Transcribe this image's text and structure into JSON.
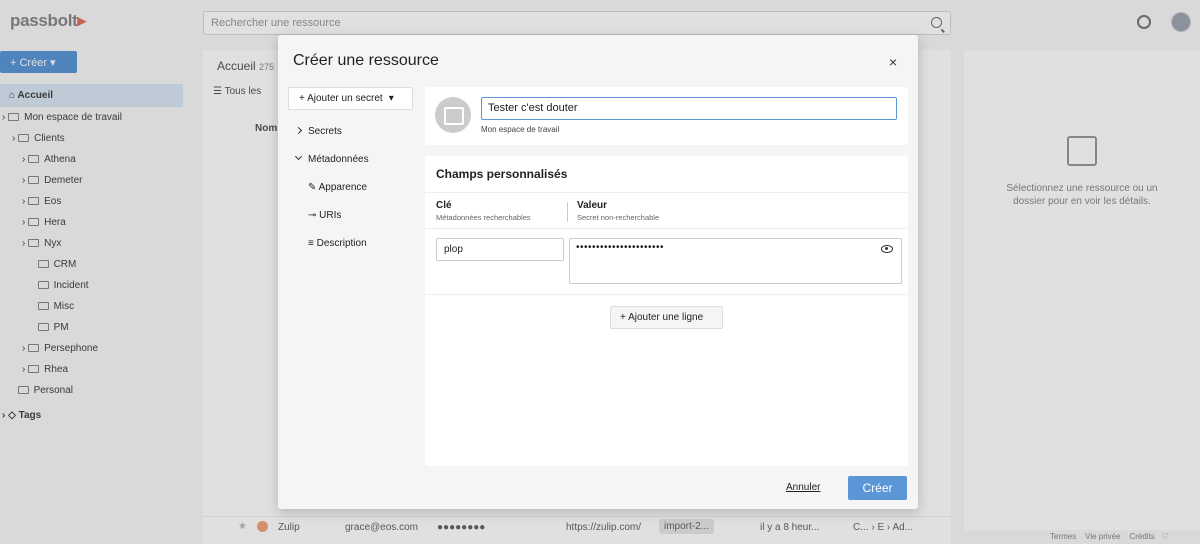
{
  "app": {
    "logo": "passbolt",
    "search_placeholder": "Rechercher une ressource",
    "create_label": "+ Créer ▾"
  },
  "sidebar": {
    "home": "Accueil",
    "tree": [
      {
        "label": "Mon espace de travail",
        "indent": 0
      },
      {
        "label": "Clients",
        "indent": 1
      },
      {
        "label": "Athena",
        "indent": 2
      },
      {
        "label": "Demeter",
        "indent": 2
      },
      {
        "label": "Eos",
        "indent": 2
      },
      {
        "label": "Hera",
        "indent": 2
      },
      {
        "label": "Nyx",
        "indent": 2
      },
      {
        "label": "CRM",
        "indent": 3
      },
      {
        "label": "Incident",
        "indent": 3
      },
      {
        "label": "Misc",
        "indent": 3
      },
      {
        "label": "PM",
        "indent": 3
      },
      {
        "label": "Persephone",
        "indent": 2
      },
      {
        "label": "Rhea",
        "indent": 2
      },
      {
        "label": "Personal",
        "indent": 1
      }
    ],
    "tags": "Tags"
  },
  "grid": {
    "title": "Accueil",
    "count": "275",
    "filter": "Tous les",
    "col_name": "Nom",
    "visible_row": {
      "name": "Zulip",
      "user": "grace@eos.com",
      "password": "●●●●●●●●",
      "uri": "https://zulip.com/",
      "tag": "import-2...",
      "modified": "il y a 8 heur...",
      "location": "C... › E › Ad..."
    }
  },
  "details": {
    "empty_text": "Sélectionnez une ressource ou un dossier pour en voir les détails."
  },
  "footer": {
    "terms": "Termes",
    "privacy": "Vie privée",
    "credits": "Crédits"
  },
  "modal": {
    "title": "Créer une ressource",
    "close": "×",
    "add_secret": "Ajouter un secret",
    "nav": {
      "secrets": "Secrets",
      "metadata": "Métadonnées",
      "appearance": "Apparence",
      "uris": "URIs",
      "description": "Description"
    },
    "resource_name": "Tester c'est douter",
    "resource_location": "Mon espace de travail",
    "custom_fields": {
      "title": "Champs personnalisés",
      "key_header": "Clé",
      "key_sub": "Métadonnées recherchables",
      "value_header": "Valeur",
      "value_sub": "Secret non-recherchable",
      "key_value": "plop",
      "secret_value": "••••••••••••••••••••••",
      "add_line": "Ajouter une ligne"
    },
    "cancel": "Annuler",
    "submit": "Créer"
  }
}
